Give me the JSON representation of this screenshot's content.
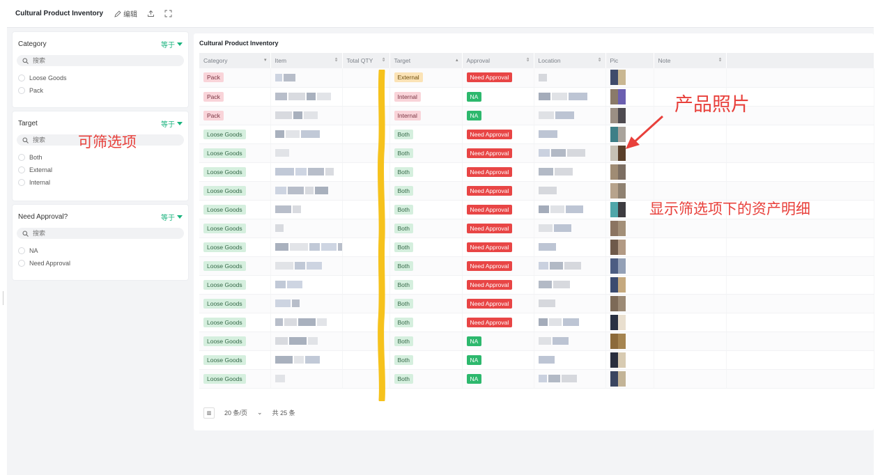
{
  "header": {
    "title": "Cultural Product Inventory",
    "edit_label": "编辑"
  },
  "filters": [
    {
      "title": "Category",
      "operator": "等于",
      "search_placeholder": "搜索",
      "options": [
        "Loose Goods",
        "Pack"
      ]
    },
    {
      "title": "Target",
      "operator": "等于",
      "search_placeholder": "搜索",
      "options": [
        "Both",
        "External",
        "Internal"
      ]
    },
    {
      "title": "Need Approval?",
      "operator": "等于",
      "search_placeholder": "搜索",
      "options": [
        "NA",
        "Need Approval"
      ]
    }
  ],
  "annotations": {
    "filter_hint": "可筛选项",
    "photo_hint": "产品照片",
    "detail_hint": "显示筛选项下的资产明细"
  },
  "table": {
    "title": "Cultural Product Inventory",
    "columns": [
      "Category",
      "Item",
      "Total QTY",
      "Target",
      "Approval",
      "Location",
      "Pic",
      "Note"
    ],
    "rows": [
      {
        "category": "Pack",
        "target": "External",
        "approval": "Need Approval"
      },
      {
        "category": "Pack",
        "target": "Internal",
        "approval": "NA"
      },
      {
        "category": "Pack",
        "target": "Internal",
        "approval": "NA"
      },
      {
        "category": "Loose Goods",
        "target": "Both",
        "approval": "Need Approval"
      },
      {
        "category": "Loose Goods",
        "target": "Both",
        "approval": "Need Approval"
      },
      {
        "category": "Loose Goods",
        "target": "Both",
        "approval": "Need Approval"
      },
      {
        "category": "Loose Goods",
        "target": "Both",
        "approval": "Need Approval"
      },
      {
        "category": "Loose Goods",
        "target": "Both",
        "approval": "Need Approval"
      },
      {
        "category": "Loose Goods",
        "target": "Both",
        "approval": "Need Approval"
      },
      {
        "category": "Loose Goods",
        "target": "Both",
        "approval": "Need Approval"
      },
      {
        "category": "Loose Goods",
        "target": "Both",
        "approval": "Need Approval"
      },
      {
        "category": "Loose Goods",
        "target": "Both",
        "approval": "Need Approval"
      },
      {
        "category": "Loose Goods",
        "target": "Both",
        "approval": "Need Approval"
      },
      {
        "category": "Loose Goods",
        "target": "Both",
        "approval": "Need Approval"
      },
      {
        "category": "Loose Goods",
        "target": "Both",
        "approval": "NA"
      },
      {
        "category": "Loose Goods",
        "target": "Both",
        "approval": "NA"
      },
      {
        "category": "Loose Goods",
        "target": "Both",
        "approval": "NA"
      }
    ]
  },
  "pagination": {
    "page_size": "20 条/页",
    "total": "共 25 条"
  }
}
